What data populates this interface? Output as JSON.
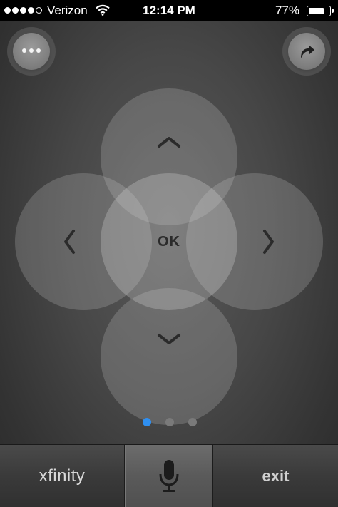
{
  "status_bar": {
    "carrier": "Verizon",
    "time": "12:14 PM",
    "battery": "77%",
    "battery_level": 0.77,
    "signal_bars_on": 4,
    "signal_bars_total": 5
  },
  "top_buttons": {
    "more_icon": "more-dots-icon",
    "share_icon": "curved-arrow-icon"
  },
  "dpad": {
    "ok_label": "OK",
    "up_icon": "chevron-up-icon",
    "down_icon": "chevron-down-icon",
    "left_icon": "chevron-left-icon",
    "right_icon": "chevron-right-icon"
  },
  "pager": {
    "pages": 3,
    "active_index": 0,
    "active_color": "#2f8ff0"
  },
  "bottom_bar": {
    "xfinity_label": "xfinity",
    "mic_icon": "microphone-icon",
    "exit_label": "exit"
  }
}
